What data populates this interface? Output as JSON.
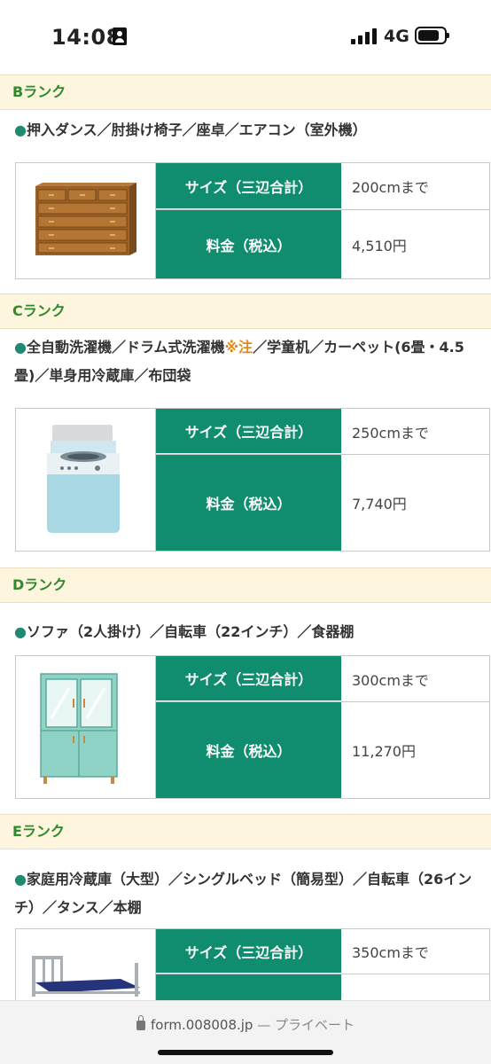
{
  "status": {
    "time": "14:08",
    "network": "4G"
  },
  "labels": {
    "size": "サイズ（三辺合計）",
    "price": "料金（税込）"
  },
  "ranks": [
    {
      "name": "Bランク",
      "items": "押入ダンス／肘掛け椅子／座卓／エアコン（室外機）",
      "size": "200cmまで",
      "price": "4,510円",
      "image": "chest-of-drawers"
    },
    {
      "name": "Cランク",
      "items_before": "全自動洗濯機／ドラム式洗濯機",
      "note": "※注",
      "items_after": "／学童机／カーペット(6畳・4.5畳)／単身用冷蔵庫／布団袋",
      "size": "250cmまで",
      "price": "7,740円",
      "image": "washing-machine"
    },
    {
      "name": "Dランク",
      "items": "ソファ（2人掛け）／自転車（22インチ）／食器棚",
      "size": "300cmまで",
      "price": "11,270円",
      "image": "cupboard"
    },
    {
      "name": "Eランク",
      "items": "家庭用冷蔵庫（大型）／シングルベッド（簡易型）／自転車（26インチ）／タンス／本棚",
      "size": "350cmまで",
      "price": "",
      "image": "bed"
    }
  ],
  "browser": {
    "url": "form.008008.jp",
    "mode": "— プライベート"
  },
  "colors": {
    "header_bg": "#fdf5dd",
    "rank_text": "#2f8a2c",
    "label_bg": "#0f8d6e",
    "note": "#e08a1e"
  }
}
